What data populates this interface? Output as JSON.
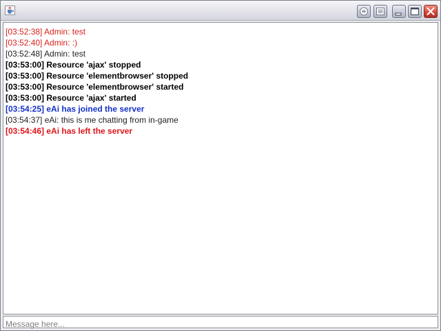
{
  "window": {
    "buttons": {
      "extra1_icon": "arrows-icon",
      "extra2_icon": "list-icon",
      "minimize_icon": "minimize-icon",
      "maximize_icon": "maximize-icon",
      "close_icon": "close-icon"
    }
  },
  "chat": {
    "lines": [
      {
        "text": "[03:52:38] Admin: test",
        "color": "#d8221b",
        "bold": false
      },
      {
        "text": "[03:52:40] Admin: :)",
        "color": "#d8221b",
        "bold": false
      },
      {
        "text": "[03:52:48] Admin: test",
        "color": "#222222",
        "bold": false
      },
      {
        "text": "[03:53:00] Resource 'ajax' stopped",
        "color": "#000000",
        "bold": true
      },
      {
        "text": "[03:53:00] Resource 'elementbrowser' stopped",
        "color": "#000000",
        "bold": true
      },
      {
        "text": "[03:53:00] Resource 'elementbrowser' started",
        "color": "#000000",
        "bold": true
      },
      {
        "text": "[03:53:00] Resource 'ajax' started",
        "color": "#000000",
        "bold": true
      },
      {
        "text": "[03:54:25] eAi has joined the server",
        "color": "#1430c8",
        "bold": true
      },
      {
        "text": "[03:54:37] eAi: this is me chatting from in-game",
        "color": "#222222",
        "bold": false
      },
      {
        "text": "[03:54:46] eAi has left the server",
        "color": "#e0141a",
        "bold": true
      }
    ]
  },
  "input": {
    "placeholder": "Message here...",
    "value": ""
  }
}
